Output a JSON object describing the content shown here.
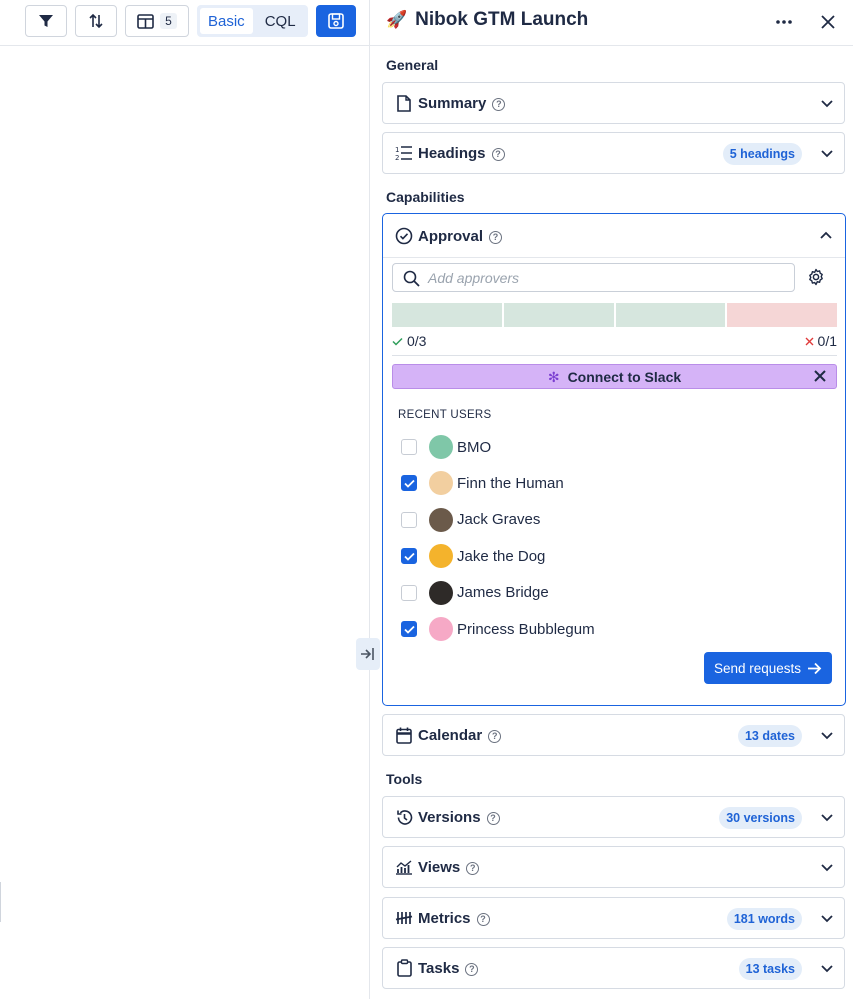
{
  "toolbar": {
    "columns_count": "5",
    "mode_basic": "Basic",
    "mode_cql": "CQL",
    "active_mode": "Basic"
  },
  "panel": {
    "title": "Nibok GTM Launch",
    "title_emoji": "🚀"
  },
  "sections": {
    "general": "General",
    "capabilities": "Capabilities",
    "tools": "Tools"
  },
  "cards": {
    "summary": {
      "label": "Summary",
      "icon": "document-icon"
    },
    "headings": {
      "label": "Headings",
      "badge": "5 headings",
      "icon": "numbered-list-icon"
    },
    "calendar": {
      "label": "Calendar",
      "badge": "13 dates",
      "icon": "calendar-icon"
    },
    "versions": {
      "label": "Versions",
      "badge": "30 versions",
      "icon": "history-icon"
    },
    "views": {
      "label": "Views",
      "icon": "chart-icon"
    },
    "metrics": {
      "label": "Metrics",
      "badge": "181 words",
      "icon": "tally-icon"
    },
    "tasks": {
      "label": "Tasks",
      "badge": "13 tasks",
      "icon": "clipboard-icon"
    }
  },
  "approval": {
    "label": "Approval",
    "search_placeholder": "Add approvers",
    "approved_count": "0/3",
    "rejected_count": "0/1",
    "progress": {
      "approved": 0,
      "approval_slots": 3,
      "rejected": 0,
      "rejection_slots": 1
    },
    "slack_label": "Connect to Slack",
    "recent_users_label": "RECENT USERS",
    "users": [
      {
        "name": "BMO",
        "checked": false,
        "color": "#7fc7a8"
      },
      {
        "name": "Finn the Human",
        "checked": true,
        "color": "#f2cfa0"
      },
      {
        "name": "Jack Graves",
        "checked": false,
        "color": "#6b5a4a"
      },
      {
        "name": "Jake the Dog",
        "checked": true,
        "color": "#f4b32c"
      },
      {
        "name": "James Bridge",
        "checked": false,
        "color": "#2e2a28"
      },
      {
        "name": "Princess Bubblegum",
        "checked": true,
        "color": "#f6a9c6"
      }
    ],
    "send_label": "Send requests"
  },
  "colors": {
    "accent": "#1a64e0",
    "slack_banner": "#d5b3f7",
    "approved_bar": "#d6e6de",
    "rejected_bar": "#f5d6d6"
  }
}
